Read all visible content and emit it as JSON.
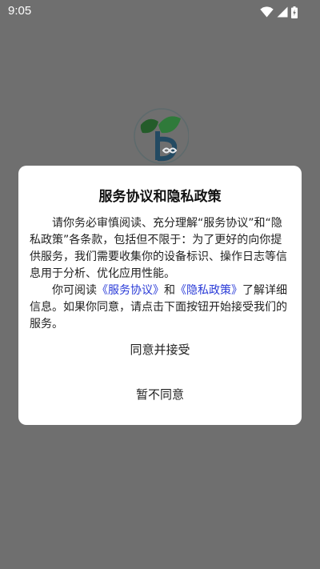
{
  "status_bar": {
    "time": "9:05",
    "icons": [
      "wifi-icon",
      "cellular-signal-icon",
      "battery-icon"
    ]
  },
  "splash": {
    "logo_icon": "app-logo-leaf-icon",
    "logo_colors": [
      "#3a8c3f",
      "#2b6e8f",
      "#1e4f7a"
    ]
  },
  "dialog": {
    "title": "服务协议和隐私政策",
    "paragraph1": "请你务必审慎阅读、充分理解“服务协议”和“隐私政策”各条款，包括但不限于：为了更好的向你提供服务，我们需要收集你的设备标识、操作日志等信息用于分析、优化应用性能。",
    "paragraph2_prefix": "你可阅读",
    "service_link": "《服务协议》",
    "and_text": "和",
    "privacy_link": "《隐私政策》",
    "paragraph2_suffix": "了解详细信息。如果你同意，请点击下面按钮开始接受我们的服务。",
    "accept_label": "同意并接受",
    "decline_label": "暂不同意",
    "link_color": "#2a3bd7"
  }
}
